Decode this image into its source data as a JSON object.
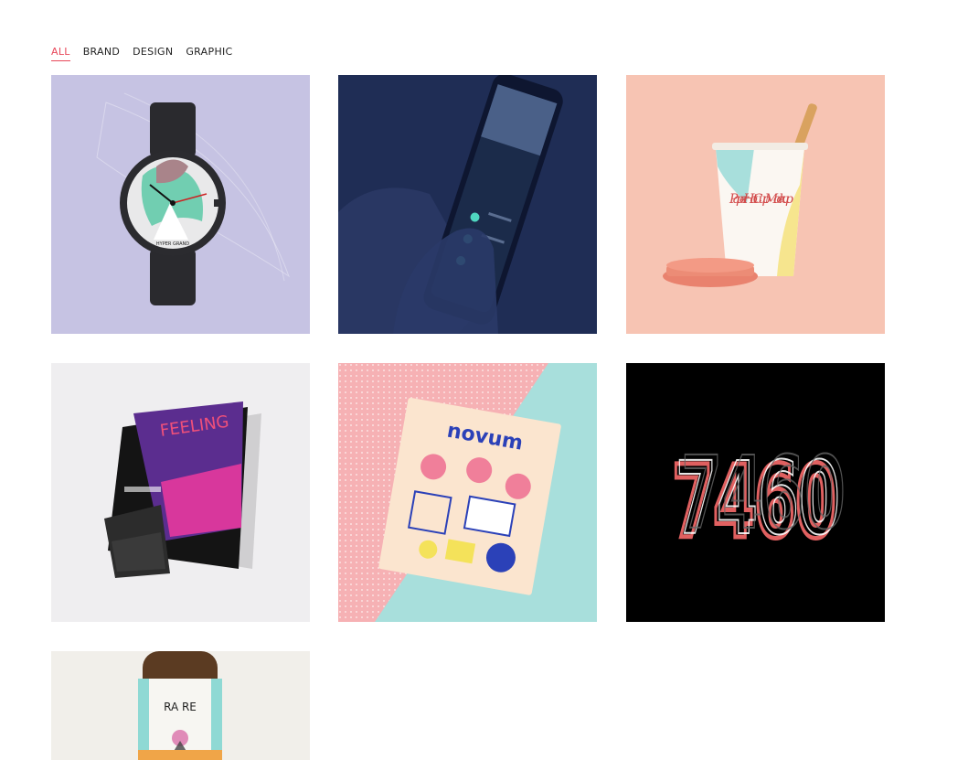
{
  "filters": [
    {
      "label": "ALL",
      "active": true
    },
    {
      "label": "BRAND",
      "active": false
    },
    {
      "label": "DESIGN",
      "active": false
    },
    {
      "label": "GRAPHIC",
      "active": false
    }
  ],
  "portfolio": {
    "items": [
      {
        "subject": "watch",
        "bg": "#c6c3e3",
        "marks": {
          "text": "HYPER GRAND"
        }
      },
      {
        "subject": "phone-in-hand",
        "bg": "#1f2d55"
      },
      {
        "subject": "paper-cup",
        "bg": "#f7c4b3",
        "marks": {
          "text": "Paper Hot Cup Mock up"
        }
      },
      {
        "subject": "magazine-open",
        "bg": "#efeef0",
        "marks": {
          "text": "FEELING"
        }
      },
      {
        "subject": "novum-magazine",
        "bg": "#a8dfdc",
        "marks": {
          "text": "novum"
        }
      },
      {
        "subject": "numbers-logo",
        "bg": "#000000",
        "marks": {
          "text": "7460"
        }
      },
      {
        "subject": "bottle",
        "bg": "#f1efea",
        "marks": {
          "text": "RA RE"
        }
      }
    ]
  }
}
